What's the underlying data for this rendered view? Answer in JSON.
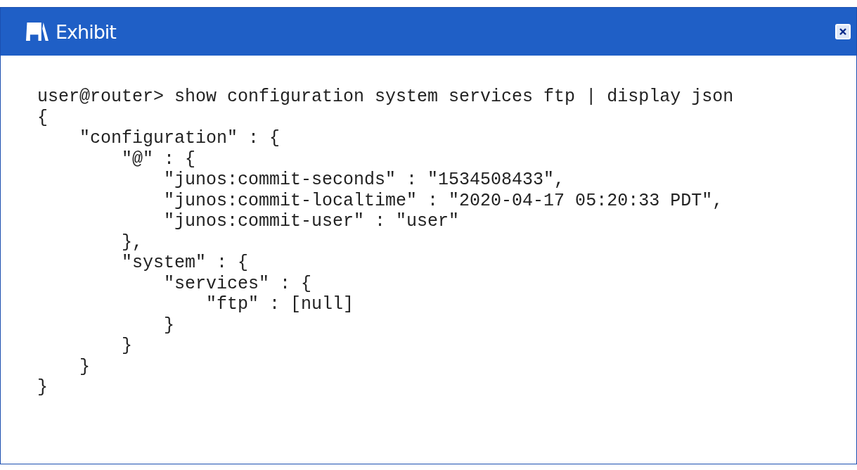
{
  "window": {
    "title": "Exhibit"
  },
  "code_lines": [
    "user@router> show configuration system services ftp | display json",
    "{",
    "    \"configuration\" : {",
    "        \"@\" : {",
    "            \"junos:commit-seconds\" : \"1534508433\",",
    "            \"junos:commit-localtime\" : \"2020-04-17 05:20:33 PDT\",",
    "            \"junos:commit-user\" : \"user\"",
    "        },",
    "        \"system\" : {",
    "            \"services\" : {",
    "                \"ftp\" : [null]",
    "            }",
    "        }",
    "    }",
    "}"
  ]
}
